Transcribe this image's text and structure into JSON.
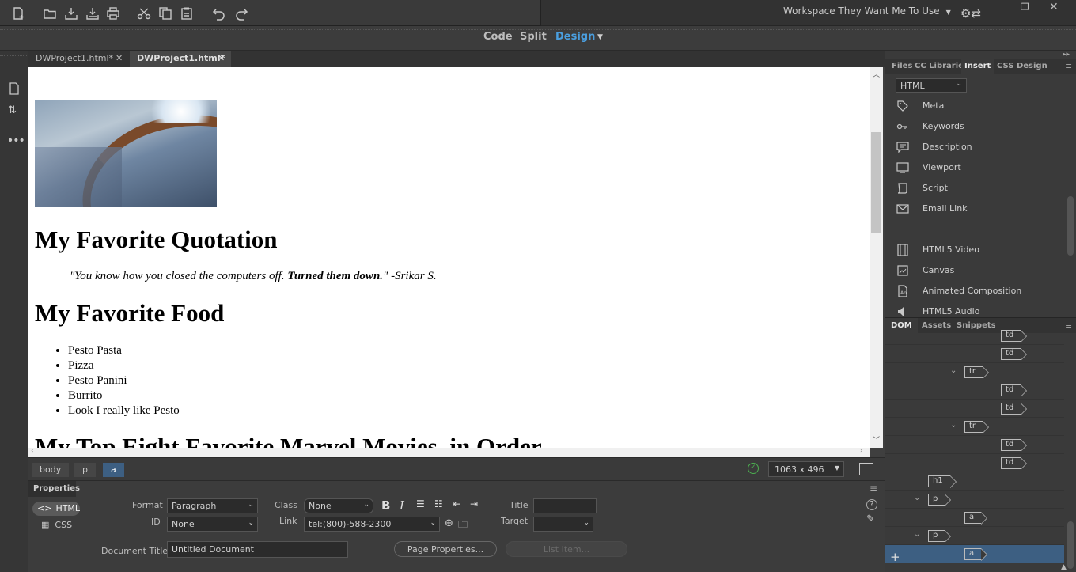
{
  "workspace": {
    "label": "Workspace They Want Me To Use"
  },
  "view_switcher": {
    "code": "Code",
    "split": "Split",
    "design": "Design",
    "active": "Design",
    "active_color": "#4a9fe0"
  },
  "doc_tabs": [
    {
      "label": "DWProject1.html*",
      "active": false
    },
    {
      "label": "DWProject1.html*",
      "active": true
    }
  ],
  "document": {
    "h1_quote": "My Favorite Quotation",
    "quote_part1": "\"You know how you closed the computers off. ",
    "quote_bold": "Turned them down.",
    "quote_part2": "\" -Srikar S.",
    "h1_food": "My Favorite Food",
    "food_list": [
      "Pesto Pasta",
      "Pizza",
      "Pesto Panini",
      "Burrito",
      "Look I really like Pesto"
    ],
    "h1_movies": "My Top Eight Favorite Marvel Movies, in Order"
  },
  "status_bar": {
    "breadcrumbs": [
      "body",
      "p",
      "a"
    ],
    "active_crumb": "a",
    "viewport_size": "1063 x 496"
  },
  "properties": {
    "panel_title": "Properties",
    "mode_html": "HTML",
    "mode_css": "CSS",
    "format_label": "Format",
    "format_value": "Paragraph",
    "id_label": "ID",
    "id_value": "None",
    "class_label": "Class",
    "class_value": "None",
    "link_label": "Link",
    "link_value": "tel:(800)-588-2300",
    "title_label": "Title",
    "title_value": "",
    "target_label": "Target",
    "target_value": "",
    "doc_title_label": "Document Title",
    "doc_title_value": "Untitled Document",
    "page_properties_btn": "Page Properties...",
    "list_item_btn": "List Item..."
  },
  "right_panel": {
    "tabs": [
      "Files",
      "CC Libraries",
      "Insert",
      "CSS Designer"
    ],
    "active_tab": "Insert",
    "category": "HTML",
    "insert_items": [
      {
        "label": "Meta",
        "icon": "tag-icon"
      },
      {
        "label": "Keywords",
        "icon": "key-icon"
      },
      {
        "label": "Description",
        "icon": "comment-icon"
      },
      {
        "label": "Viewport",
        "icon": "monitor-icon"
      },
      {
        "label": "Script",
        "icon": "scroll-icon"
      },
      {
        "label": "Email Link",
        "icon": "envelope-icon"
      }
    ],
    "insert_items_media": [
      {
        "label": "HTML5 Video",
        "icon": "film-icon"
      },
      {
        "label": "Canvas",
        "icon": "canvas-icon"
      },
      {
        "label": "Animated Composition",
        "icon": "animate-icon"
      },
      {
        "label": "HTML5 Audio",
        "icon": "speaker-icon"
      }
    ],
    "dom_tabs": [
      "DOM",
      "Assets",
      "Snippets"
    ],
    "dom_active": "DOM",
    "dom_tree": [
      {
        "tag": "td",
        "indent": 3,
        "chevron": false
      },
      {
        "tag": "td",
        "indent": 3,
        "chevron": false
      },
      {
        "tag": "tr",
        "indent": 2,
        "chevron": true
      },
      {
        "tag": "td",
        "indent": 3,
        "chevron": false
      },
      {
        "tag": "td",
        "indent": 3,
        "chevron": false
      },
      {
        "tag": "tr",
        "indent": 2,
        "chevron": true
      },
      {
        "tag": "td",
        "indent": 3,
        "chevron": false
      },
      {
        "tag": "td",
        "indent": 3,
        "chevron": false
      },
      {
        "tag": "h1",
        "indent": 1,
        "chevron": false
      },
      {
        "tag": "p",
        "indent": 1,
        "chevron": true
      },
      {
        "tag": "a",
        "indent": 2,
        "chevron": false
      },
      {
        "tag": "p",
        "indent": 1,
        "chevron": true
      },
      {
        "tag": "a",
        "indent": 2,
        "chevron": false,
        "selected": true
      }
    ]
  }
}
